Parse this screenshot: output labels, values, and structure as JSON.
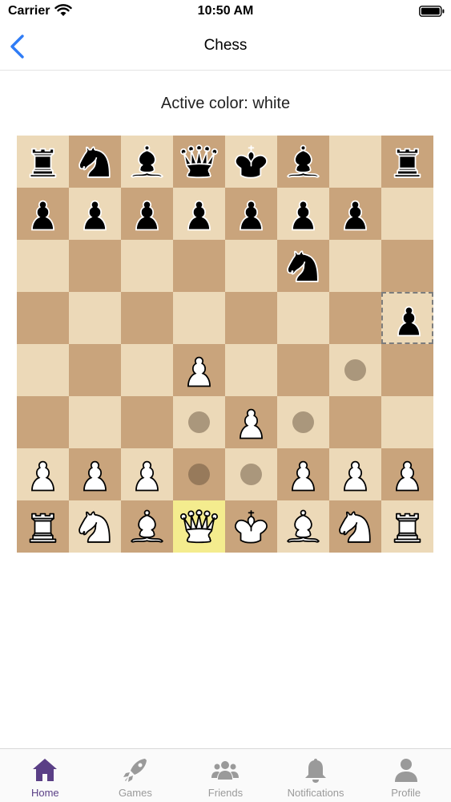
{
  "status_bar": {
    "carrier": "Carrier",
    "time": "10:50 AM"
  },
  "nav": {
    "title": "Chess"
  },
  "game": {
    "active_color": "Active color: white"
  },
  "board": {
    "rows": [
      [
        "r",
        "n",
        "b",
        "q",
        "k",
        "b",
        "",
        "r"
      ],
      [
        "p",
        "p",
        "p",
        "p",
        "p",
        "p",
        "p",
        ""
      ],
      [
        "",
        "",
        "",
        "",
        "",
        "n",
        "",
        ""
      ],
      [
        "",
        "",
        "",
        "",
        "",
        "",
        "",
        "p"
      ],
      [
        "",
        "",
        "",
        "P",
        "",
        "",
        "",
        ""
      ],
      [
        "",
        "",
        "",
        "",
        "P",
        "",
        "",
        ""
      ],
      [
        "P",
        "P",
        "P",
        "",
        "",
        "P",
        "P",
        "P"
      ],
      [
        "R",
        "N",
        "B",
        "Q",
        "K",
        "B",
        "N",
        "R"
      ]
    ],
    "highlighted": [
      [
        7,
        3
      ]
    ],
    "selected": [
      [
        3,
        7
      ]
    ],
    "move_dots": [
      [
        4,
        6
      ],
      [
        5,
        3
      ],
      [
        5,
        5
      ],
      [
        6,
        3
      ],
      [
        6,
        4
      ]
    ]
  },
  "tabs": [
    {
      "id": "home",
      "label": "Home",
      "icon": "house-icon",
      "active": true
    },
    {
      "id": "games",
      "label": "Games",
      "icon": "rocket-icon",
      "active": false
    },
    {
      "id": "friends",
      "label": "Friends",
      "icon": "people-icon",
      "active": false
    },
    {
      "id": "notifications",
      "label": "Notifications",
      "icon": "bell-icon",
      "active": false
    },
    {
      "id": "profile",
      "label": "Profile",
      "icon": "person-icon",
      "active": false
    }
  ],
  "colors": {
    "accent": "#5a3f86",
    "light_square": "#ecd9b8",
    "dark_square": "#c9a47c",
    "highlight": "#f4ec8e",
    "back_button": "#2f7cf6"
  }
}
